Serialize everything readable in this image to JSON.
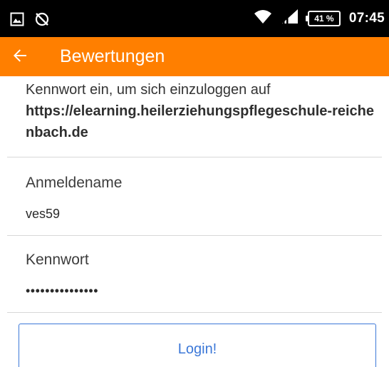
{
  "status_bar": {
    "battery_percent": "41 %",
    "time": "07:45",
    "icons": [
      "image-icon",
      "sync-disabled-icon",
      "wifi-icon",
      "signal-icon",
      "battery-icon"
    ]
  },
  "app_bar": {
    "title": "Bewertungen",
    "background_color": "#ff7f00"
  },
  "intro": {
    "text": "Kennwort ein, um sich einzuloggen auf",
    "url": "https://elearning.heilerziehungspflegeschule-reichenbach.de"
  },
  "login_form": {
    "username": {
      "label": "Anmeldename",
      "value": "ves59"
    },
    "password": {
      "label": "Kennwort",
      "value": "•••••••••••••••"
    },
    "submit_label": "Login!",
    "accent_color": "#3c78d8"
  }
}
